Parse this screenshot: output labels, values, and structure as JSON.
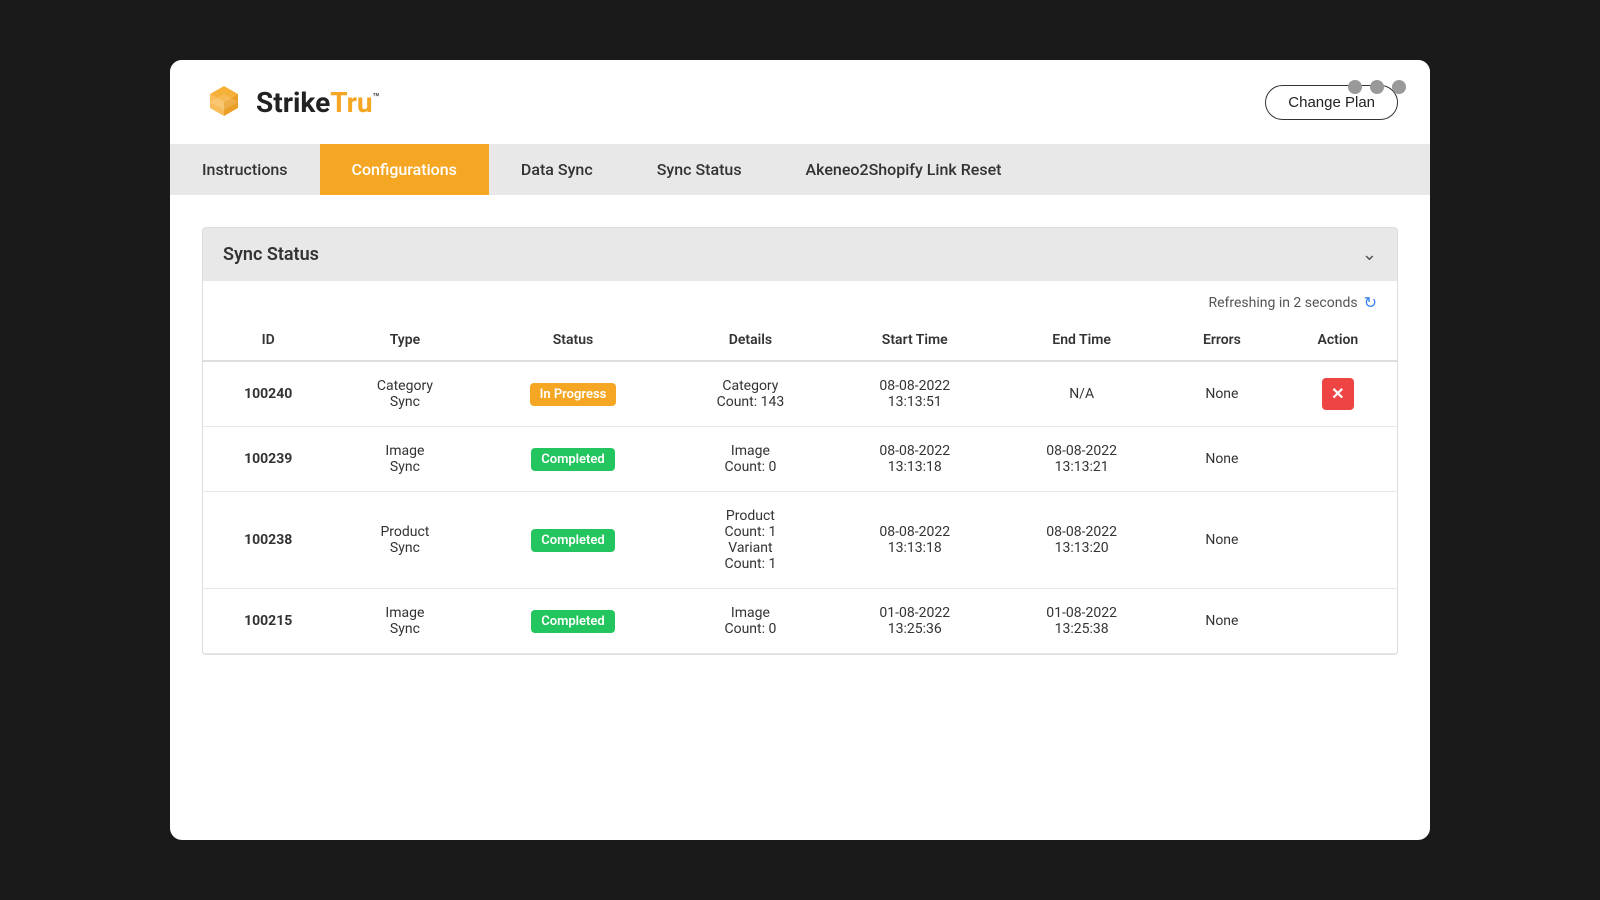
{
  "window": {
    "dots": [
      "dot1",
      "dot2",
      "dot3"
    ]
  },
  "logo": {
    "strike": "Strike",
    "tru": "Tru",
    "tm": "™"
  },
  "header": {
    "change_plan_label": "Change Plan"
  },
  "nav": {
    "items": [
      {
        "id": "instructions",
        "label": "Instructions",
        "active": false
      },
      {
        "id": "configurations",
        "label": "Configurations",
        "active": true
      },
      {
        "id": "data-sync",
        "label": "Data Sync",
        "active": false
      },
      {
        "id": "sync-status",
        "label": "Sync Status",
        "active": false
      },
      {
        "id": "akeneo-link-reset",
        "label": "Akeneo2Shopify Link Reset",
        "active": false
      }
    ]
  },
  "sync_status_section": {
    "title": "Sync Status",
    "refresh_text": "Refreshing in 2 seconds",
    "chevron": "∨"
  },
  "table": {
    "columns": [
      "ID",
      "Type",
      "Status",
      "Details",
      "Start Time",
      "End Time",
      "Errors",
      "Action"
    ],
    "rows": [
      {
        "id": "100240",
        "type": "Category\nSync",
        "status": "In Progress",
        "status_type": "in-progress",
        "details": "Category\nCount: 143",
        "start_time": "08-08-2022\n13:13:51",
        "end_time": "N/A",
        "errors": "None",
        "has_action": true,
        "action_label": "✕"
      },
      {
        "id": "100239",
        "type": "Image\nSync",
        "status": "Completed",
        "status_type": "completed",
        "details": "Image\nCount: 0",
        "start_time": "08-08-2022\n13:13:18",
        "end_time": "08-08-2022\n13:13:21",
        "errors": "None",
        "has_action": false,
        "action_label": ""
      },
      {
        "id": "100238",
        "type": "Product\nSync",
        "status": "Completed",
        "status_type": "completed",
        "details": "Product\nCount: 1\nVariant\nCount: 1",
        "start_time": "08-08-2022\n13:13:18",
        "end_time": "08-08-2022\n13:13:20",
        "errors": "None",
        "has_action": false,
        "action_label": ""
      },
      {
        "id": "100215",
        "type": "Image\nSync",
        "status": "Completed",
        "status_type": "completed",
        "details": "Image\nCount: 0",
        "start_time": "01-08-2022\n13:25:36",
        "end_time": "01-08-2022\n13:25:38",
        "errors": "None",
        "has_action": false,
        "action_label": ""
      }
    ]
  }
}
